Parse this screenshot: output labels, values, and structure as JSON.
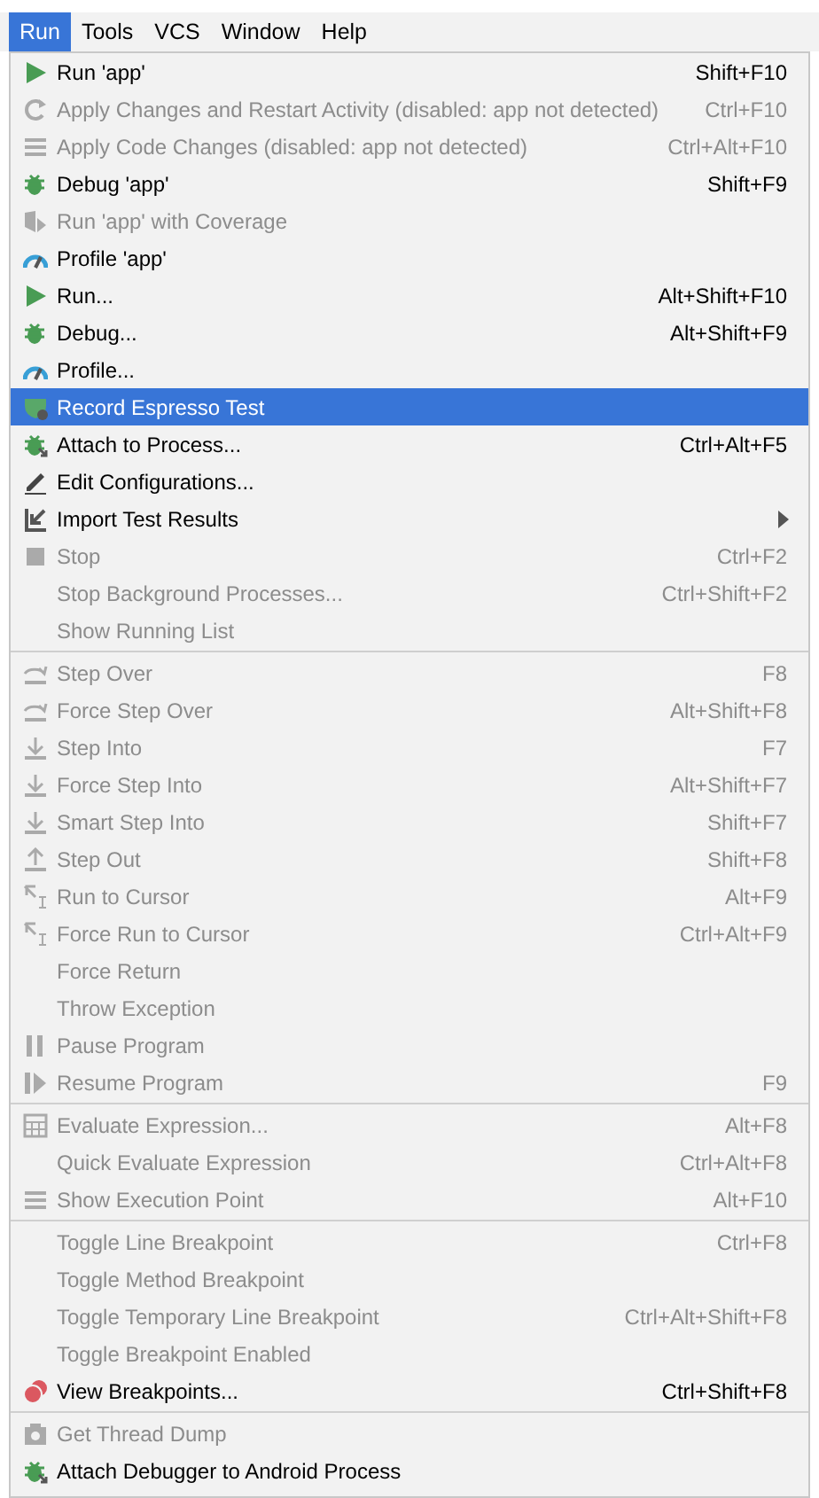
{
  "menubar": [
    {
      "label": "Run",
      "selected": true
    },
    {
      "label": "Tools",
      "selected": false
    },
    {
      "label": "VCS",
      "selected": false
    },
    {
      "label": "Window",
      "selected": false
    },
    {
      "label": "Help",
      "selected": false
    }
  ],
  "menu": {
    "sections": [
      {
        "items": [
          {
            "label": "Run 'app'",
            "shortcut": "Shift+F10",
            "disabled": false,
            "selected": false
          },
          {
            "label": "Apply Changes and Restart Activity (disabled: app not detected)",
            "shortcut": "Ctrl+F10",
            "disabled": true,
            "selected": false
          },
          {
            "label": "Apply Code Changes (disabled: app not detected)",
            "shortcut": "Ctrl+Alt+F10",
            "disabled": true,
            "selected": false
          },
          {
            "label": "Debug 'app'",
            "shortcut": "Shift+F9",
            "disabled": false,
            "selected": false
          },
          {
            "label": "Run 'app' with Coverage",
            "disabled": true,
            "selected": false
          },
          {
            "label": "Profile 'app'",
            "disabled": false,
            "selected": false
          },
          {
            "label": "Run...",
            "shortcut": "Alt+Shift+F10",
            "disabled": false,
            "selected": false
          },
          {
            "label": "Debug...",
            "shortcut": "Alt+Shift+F9",
            "disabled": false,
            "selected": false
          },
          {
            "label": "Profile...",
            "disabled": false,
            "selected": false
          },
          {
            "label": "Record Espresso Test",
            "disabled": false,
            "selected": true
          },
          {
            "label": "Attach to Process...",
            "shortcut": "Ctrl+Alt+F5",
            "disabled": false,
            "selected": false
          },
          {
            "label": "Edit Configurations...",
            "disabled": false,
            "selected": false
          },
          {
            "label": "Import Test Results",
            "disabled": false,
            "selected": false,
            "submenu": true
          },
          {
            "label": "Stop",
            "shortcut": "Ctrl+F2",
            "disabled": true,
            "selected": false
          },
          {
            "label": "Stop Background Processes...",
            "shortcut": "Ctrl+Shift+F2",
            "disabled": true,
            "selected": false
          },
          {
            "label": "Show Running List",
            "disabled": true,
            "selected": false
          }
        ]
      },
      {
        "items": [
          {
            "label": "Step Over",
            "shortcut": "F8",
            "disabled": true,
            "selected": false
          },
          {
            "label": "Force Step Over",
            "shortcut": "Alt+Shift+F8",
            "disabled": true,
            "selected": false
          },
          {
            "label": "Step Into",
            "shortcut": "F7",
            "disabled": true,
            "selected": false
          },
          {
            "label": "Force Step Into",
            "shortcut": "Alt+Shift+F7",
            "disabled": true,
            "selected": false
          },
          {
            "label": "Smart Step Into",
            "shortcut": "Shift+F7",
            "disabled": true,
            "selected": false
          },
          {
            "label": "Step Out",
            "shortcut": "Shift+F8",
            "disabled": true,
            "selected": false
          },
          {
            "label": "Run to Cursor",
            "shortcut": "Alt+F9",
            "disabled": true,
            "selected": false
          },
          {
            "label": "Force Run to Cursor",
            "shortcut": "Ctrl+Alt+F9",
            "disabled": true,
            "selected": false
          },
          {
            "label": "Force Return",
            "disabled": true,
            "selected": false
          },
          {
            "label": "Throw Exception",
            "disabled": true,
            "selected": false
          },
          {
            "label": "Pause Program",
            "disabled": true,
            "selected": false
          },
          {
            "label": "Resume Program",
            "shortcut": "F9",
            "disabled": true,
            "selected": false
          }
        ]
      },
      {
        "items": [
          {
            "label": "Evaluate Expression...",
            "shortcut": "Alt+F8",
            "disabled": true,
            "selected": false
          },
          {
            "label": "Quick Evaluate Expression",
            "shortcut": "Ctrl+Alt+F8",
            "disabled": true,
            "selected": false
          },
          {
            "label": "Show Execution Point",
            "shortcut": "Alt+F10",
            "disabled": true,
            "selected": false
          }
        ]
      },
      {
        "items": [
          {
            "label": "Toggle Line Breakpoint",
            "shortcut": "Ctrl+F8",
            "disabled": true,
            "selected": false
          },
          {
            "label": "Toggle Method Breakpoint",
            "disabled": true,
            "selected": false
          },
          {
            "label": "Toggle Temporary Line Breakpoint",
            "shortcut": "Ctrl+Alt+Shift+F8",
            "disabled": true,
            "selected": false
          },
          {
            "label": "Toggle Breakpoint Enabled",
            "disabled": true,
            "selected": false
          },
          {
            "label": "View Breakpoints...",
            "shortcut": "Ctrl+Shift+F8",
            "disabled": false,
            "selected": false
          }
        ]
      },
      {
        "items": [
          {
            "label": "Get Thread Dump",
            "disabled": true,
            "selected": false
          },
          {
            "label": "Attach Debugger to Android Process",
            "disabled": false,
            "selected": false
          }
        ]
      }
    ]
  }
}
